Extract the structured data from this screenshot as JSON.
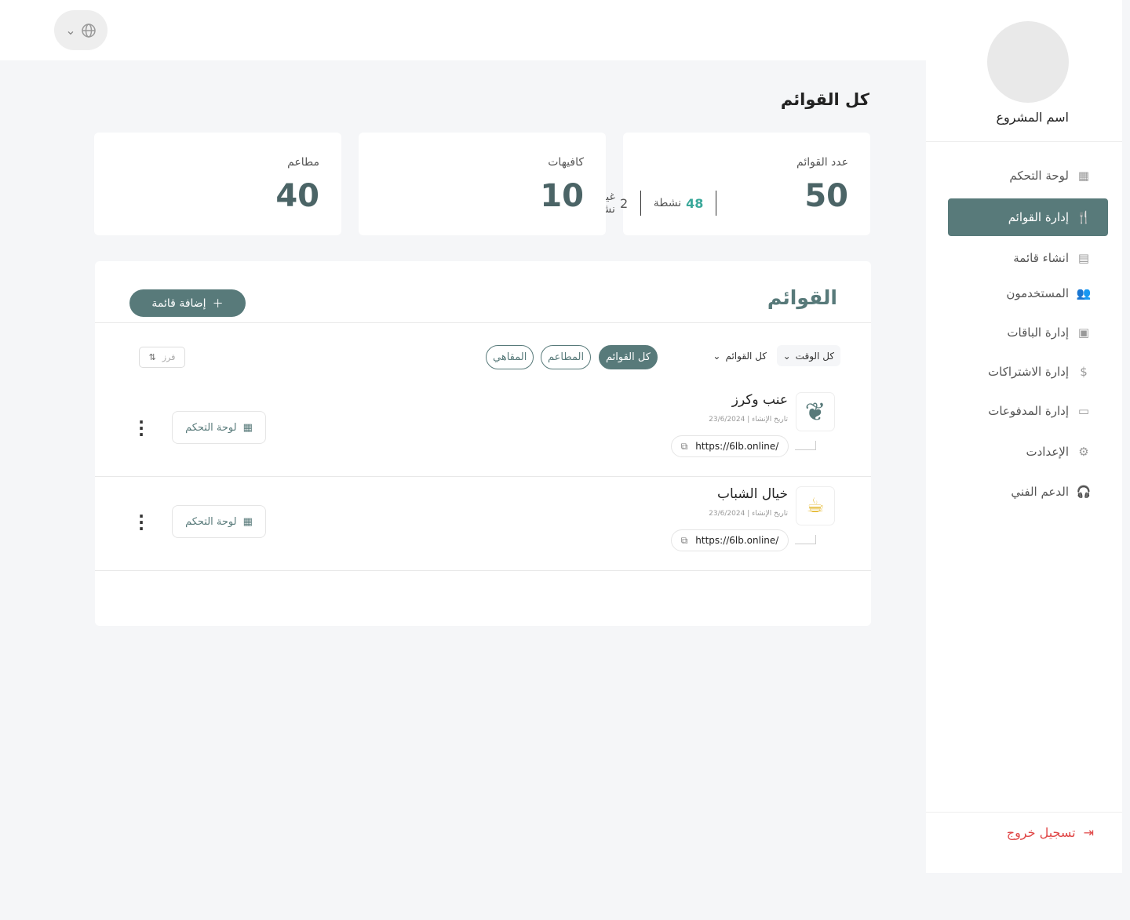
{
  "colors": {
    "accent": "#587a7a",
    "logout": "#e04848"
  },
  "header": {
    "language_icon": "globe-icon"
  },
  "sidebar": {
    "project_name": "اسم المشروع",
    "items": [
      {
        "label": "لوحة التحكم",
        "icon": "grid-icon"
      },
      {
        "label": "إدارة القوائم",
        "icon": "menu-icon",
        "active": true
      },
      {
        "label": "انشاء قائمة",
        "icon": "document-icon"
      },
      {
        "label": "المستخدمون",
        "icon": "users-icon"
      },
      {
        "label": "إدارة الباقات",
        "icon": "package-icon"
      },
      {
        "label": "إدارة الاشتراكات",
        "icon": "subscription-icon"
      },
      {
        "label": "إدارة المدفوعات",
        "icon": "payments-icon"
      },
      {
        "label": "الإعدادت",
        "icon": "gear-icon"
      },
      {
        "label": "الدعم الفني",
        "icon": "headset-icon"
      }
    ],
    "logout": "تسجيل خروج"
  },
  "page": {
    "title": "كل القوائم"
  },
  "stats": {
    "total": {
      "label": "عدد القوائم",
      "value": "50",
      "active_count": "48",
      "active_label": "نشطة",
      "inactive_count": "2",
      "inactive_label": "غير نشطة"
    },
    "cafes": {
      "label": "كافيهات",
      "value": "10"
    },
    "restaurants": {
      "label": "مطاعم",
      "value": "40"
    }
  },
  "lists": {
    "title": "القوائم",
    "add_label": "إضافة قائمة",
    "filters": {
      "time": "كل الوقت",
      "lists": "كل القوائم",
      "pills": [
        "كل القوائم",
        "المطاعم",
        "المقاهي"
      ],
      "sort": "فرز"
    },
    "rows": [
      {
        "name": "عنب وكرز",
        "date": "تاريخ الإنشاء | 23/6/2024",
        "url": "https://6lb.online/",
        "dashboard": "لوحة التحكم"
      },
      {
        "name": "خيال الشباب",
        "date": "تاريخ الإنشاء | 23/6/2024",
        "url": "https://6lb.online/",
        "dashboard": "لوحة التحكم"
      }
    ]
  }
}
